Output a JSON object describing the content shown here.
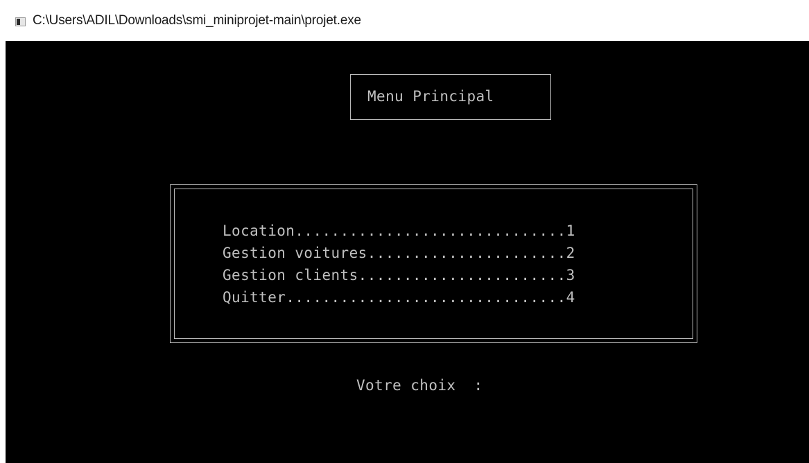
{
  "window": {
    "title": "C:\\Users\\ADIL\\Downloads\\smi_miniprojet-main\\projet.exe",
    "icon": "console-app-icon"
  },
  "console": {
    "menu_title": "Menu Principal",
    "options": [
      {
        "label": "Location",
        "dots": "..............................",
        "number": "1"
      },
      {
        "label": "Gestion voitures",
        "dots": "......................",
        "number": "2"
      },
      {
        "label": "Gestion clients",
        "dots": ".......................",
        "number": "3"
      },
      {
        "label": "Quitter",
        "dots": "...............................",
        "number": "4"
      }
    ],
    "prompt": "Votre choix  :"
  },
  "colors": {
    "console_background": "#000000",
    "console_text": "#c0c0c0"
  }
}
